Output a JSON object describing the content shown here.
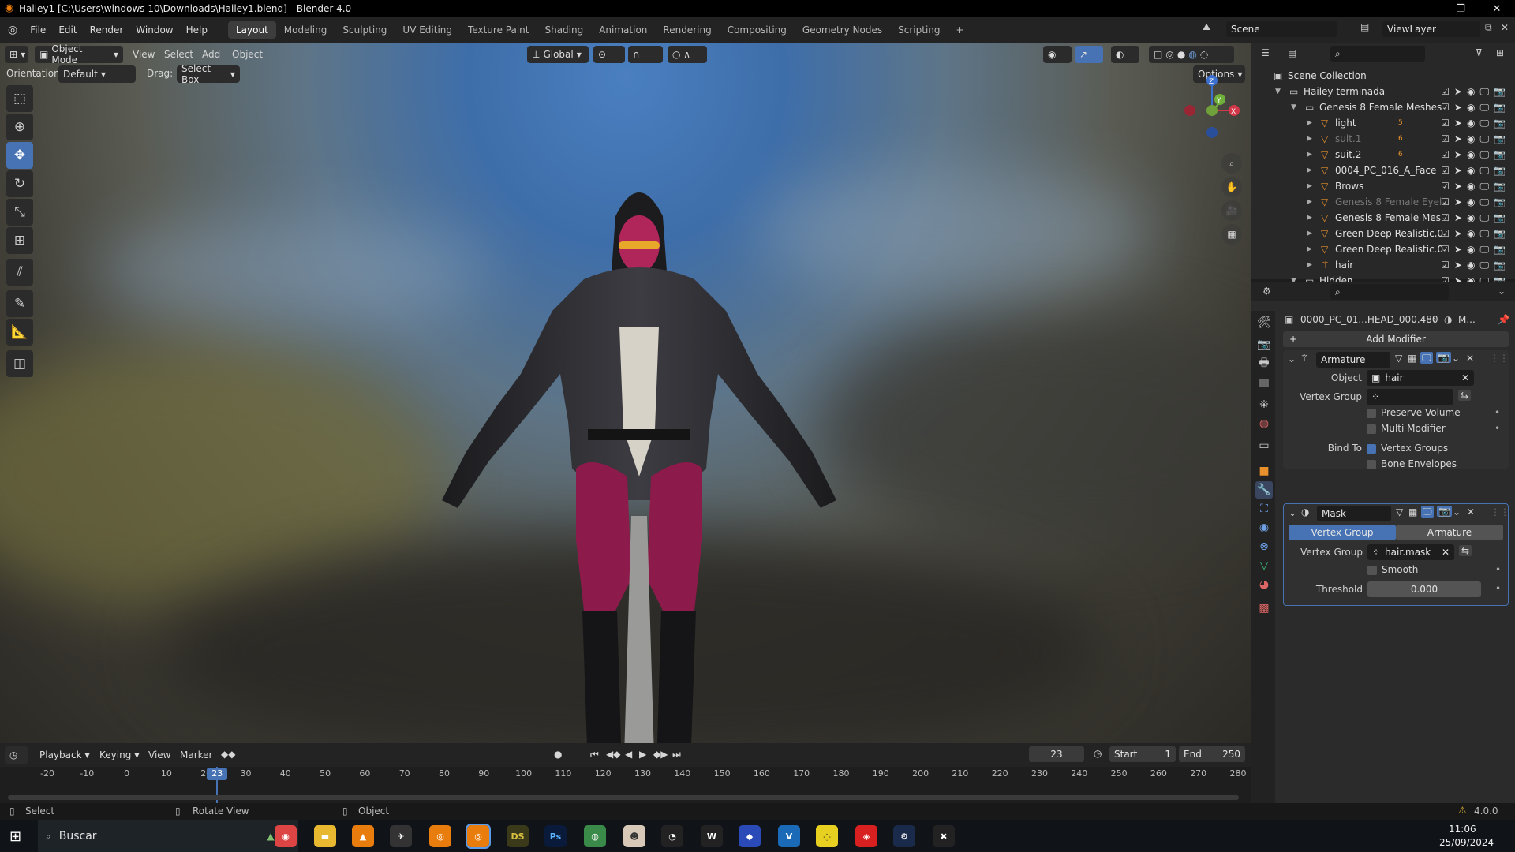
{
  "window": {
    "title": "Hailey1 [C:\\Users\\windows 10\\Downloads\\Hailey1.blend] - Blender 4.0",
    "minimize": "–",
    "restore": "❐",
    "close": "✕"
  },
  "menu": [
    "File",
    "Edit",
    "Render",
    "Window",
    "Help"
  ],
  "workspaces": [
    "Layout",
    "Modeling",
    "Sculpting",
    "UV Editing",
    "Texture Paint",
    "Shading",
    "Animation",
    "Rendering",
    "Compositing",
    "Geometry Nodes",
    "Scripting",
    "+"
  ],
  "scene": {
    "name": "Scene",
    "view_layer": "ViewLayer"
  },
  "viewport": {
    "mode": "Object Mode",
    "menus": [
      "View",
      "Select",
      "Add",
      "Object"
    ],
    "transform": "Global",
    "orientation_label": "Orientation:",
    "orientation": "Default",
    "drag_label": "Drag:",
    "drag": "Select Box",
    "options": "Options",
    "gizmo": {
      "z": "Z",
      "y": "Y",
      "x": "X"
    }
  },
  "outliner": {
    "rows": [
      {
        "label": "Scene Collection",
        "indent": 0,
        "dim": false
      },
      {
        "label": "Hailey terminada",
        "indent": 1,
        "dim": false
      },
      {
        "label": "Genesis 8 Female Meshes",
        "indent": 2,
        "dim": false
      },
      {
        "label": "light",
        "indent": 3,
        "dim": false,
        "badge": "5"
      },
      {
        "label": "suit.1",
        "indent": 3,
        "dim": true,
        "badge": "6"
      },
      {
        "label": "suit.2",
        "indent": 3,
        "dim": false,
        "badge": "6"
      },
      {
        "label": "0004_PC_016_A_Face",
        "indent": 3,
        "dim": false
      },
      {
        "label": "Brows",
        "indent": 3,
        "dim": false
      },
      {
        "label": "Genesis 8 Female Eyel",
        "indent": 3,
        "dim": true
      },
      {
        "label": "Genesis 8 Female Mes",
        "indent": 3,
        "dim": false
      },
      {
        "label": "Green Deep Realistic.0",
        "indent": 3,
        "dim": false
      },
      {
        "label": "Green Deep Realistic.0",
        "indent": 3,
        "dim": false
      },
      {
        "label": "hair",
        "indent": 3,
        "dim": false
      },
      {
        "label": "Hidden",
        "indent": 2,
        "dim": false
      }
    ]
  },
  "properties": {
    "breadcrumb": "0000_PC_01...HEAD_000.480",
    "breadcrumb_tail": "M...",
    "add_modifier": "Add Modifier",
    "armature": {
      "name": "Armature",
      "object_label": "Object",
      "object": "hair",
      "vgroup_label": "Vertex Group",
      "vgroup": "",
      "preserve": "Preserve Volume",
      "multi": "Multi Modifier",
      "bind_label": "Bind To",
      "vertex_groups": "Vertex Groups",
      "bone_env": "Bone Envelopes"
    },
    "mask": {
      "name": "Mask",
      "tab_vg": "Vertex Group",
      "tab_arm": "Armature",
      "vgroup_label": "Vertex Group",
      "vgroup": "hair.mask",
      "smooth": "Smooth",
      "threshold_label": "Threshold",
      "threshold": "0.000"
    }
  },
  "timeline": {
    "menus": [
      "Playback",
      "Keying",
      "View",
      "Marker"
    ],
    "current_frame": "23",
    "start_label": "Start",
    "start": "1",
    "end_label": "End",
    "end": "250",
    "ticks": [
      "-20",
      "-10",
      "0",
      "10",
      "20",
      "30",
      "40",
      "50",
      "60",
      "70",
      "80",
      "90",
      "100",
      "110",
      "120",
      "130",
      "140",
      "150",
      "160",
      "170",
      "180",
      "190",
      "200",
      "210",
      "220",
      "230",
      "240",
      "250",
      "260",
      "270",
      "280"
    ],
    "playhead": "23"
  },
  "status": {
    "select": "Select",
    "rotate": "Rotate View",
    "object": "Object",
    "version": "4.0.0"
  },
  "taskbar": {
    "search": "Buscar",
    "time": "11:06",
    "date": "25/09/2024",
    "icons": [
      "chrome",
      "explorer",
      "vlc",
      "bird",
      "blender",
      "blender-active",
      "daz",
      "photoshop",
      "maps",
      "game",
      "steam-like",
      "word",
      "shield",
      "v",
      "messenger",
      "vpn",
      "steam",
      "tool"
    ]
  }
}
